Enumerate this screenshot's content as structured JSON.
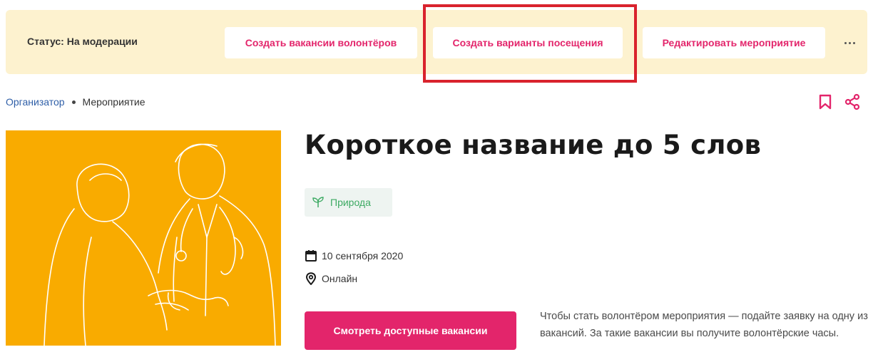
{
  "status_bar": {
    "status_text": "Статус: На модерации",
    "buttons": {
      "create_vacancies": "Создать вакансии волонтёров",
      "create_visit_options": "Создать варианты посещения",
      "edit_event": "Редактировать мероприятие"
    },
    "more_icon": "more-dots-icon",
    "bg_color": "#fdf2cf",
    "accent_color": "#e3256b",
    "highlight_color": "#d9232d"
  },
  "breadcrumb": {
    "items": [
      "Организатор",
      "Мероприятие"
    ]
  },
  "header_icons": [
    "bookmark-icon",
    "share-icon"
  ],
  "event": {
    "title": "Короткое название до 5 слов",
    "tag": {
      "label": "Природа",
      "icon": "sprout-icon",
      "color": "#3daa63"
    },
    "date": "10 сентября 2020",
    "date_icon": "calendar-icon",
    "location": "Онлайн",
    "location_icon": "map-pin-icon",
    "cta_label": "Смотреть доступные вакансии",
    "cta_note": "Чтобы стать волонтёром мероприятия — подайте заявку на одну из вакансий. За такие вакансии вы получите волонтёрские часы.",
    "image_bg": "#f9ab00",
    "image_alt": "doctor-illustration"
  }
}
